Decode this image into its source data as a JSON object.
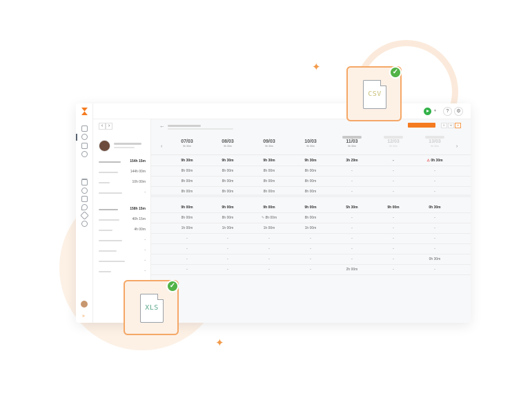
{
  "colors": {
    "accent": "#f47b20",
    "success": "#52b347",
    "play": "#33b249"
  },
  "topbar": {
    "help_icon": "?",
    "tools_icon": "⚙"
  },
  "people_panel": {
    "prev_label": "‹",
    "next_label": "›",
    "rows": [
      {
        "value": "154h 15m"
      },
      {
        "value": "144h 00m"
      },
      {
        "value": "10h 00m"
      },
      {
        "value": "-"
      },
      {
        "value": "158h 15m"
      },
      {
        "value": "40h 15m"
      },
      {
        "value": "4h 00m"
      },
      {
        "value": "-"
      },
      {
        "value": "-"
      },
      {
        "value": "-"
      },
      {
        "value": "-"
      }
    ]
  },
  "main": {
    "back_label": "←",
    "views": [
      "D",
      "W",
      "M"
    ],
    "days": [
      {
        "date": "07/03",
        "sub": "9h 30m"
      },
      {
        "date": "08/03",
        "sub": "9h 30m"
      },
      {
        "date": "09/03",
        "sub": "9h 30m"
      },
      {
        "date": "10/03",
        "sub": "9h 30m"
      },
      {
        "date": "11/03",
        "sub": "9h 30m"
      },
      {
        "date": "12/03",
        "sub": "9h 30m"
      },
      {
        "date": "13/03",
        "sub": "9h 30m"
      }
    ],
    "rows": [
      [
        "9h 30m",
        "9h 30m",
        "9h 30m",
        "9h 30m",
        "3h 29m",
        "-",
        "0h 30m"
      ],
      [
        "8h 00m",
        "8h 00m",
        "8h 00m",
        "8h 00m",
        "-",
        "-",
        "-"
      ],
      [
        "8h 00m",
        "8h 00m",
        "8h 00m",
        "8h 00m",
        "-",
        "-",
        "-"
      ],
      [
        "8h 00m",
        "8h 00m",
        "8h 00m",
        "8h 00m",
        "-",
        "-",
        "-"
      ],
      [
        "9h 00m",
        "9h 00m",
        "9h 00m",
        "9h 00m",
        "5h 30m",
        "9h 00m",
        "0h 30m"
      ],
      [
        "8h 00m",
        "8h 00m",
        "8h 00m",
        "8h 00m",
        "-",
        "-",
        "-"
      ],
      [
        "1h 00m",
        "1h 00m",
        "1h 00m",
        "1h 00m",
        "-",
        "-",
        "-"
      ],
      [
        "-",
        "-",
        "-",
        "-",
        "-",
        "-",
        "-"
      ],
      [
        "-",
        "-",
        "-",
        "-",
        "-",
        "-",
        "-"
      ],
      [
        "-",
        "-",
        "-",
        "-",
        "-",
        "-",
        "0h 30m"
      ],
      [
        "-",
        "-",
        "-",
        "-",
        "2h 00m",
        "-",
        "-"
      ]
    ]
  },
  "export_cards": {
    "csv": {
      "label": "CSV",
      "text_color": "#c9c07a"
    },
    "xls": {
      "label": "XLS",
      "text_color": "#5aa889"
    }
  }
}
